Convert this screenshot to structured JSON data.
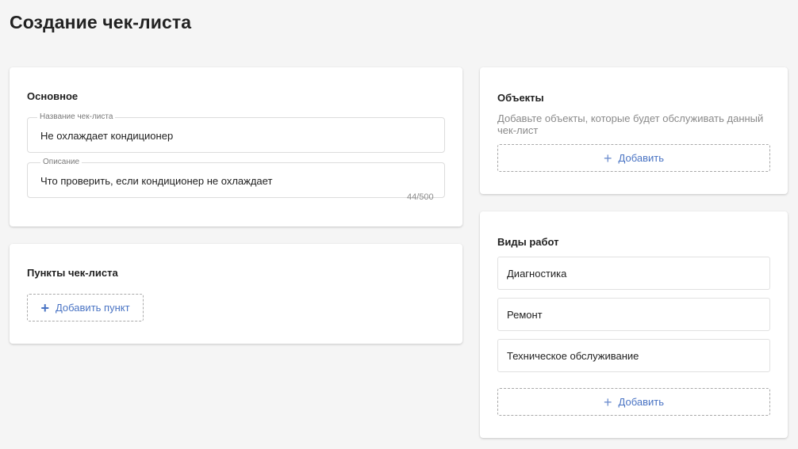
{
  "page": {
    "title": "Создание чек-листа"
  },
  "basic": {
    "title": "Основное",
    "name_field": {
      "label": "Название чек-листа",
      "value": "Не охлаждает кондиционер"
    },
    "description_field": {
      "label": "Описание",
      "value": "Что проверить, если кондиционер не охлаждает",
      "counter": "44/500"
    }
  },
  "checklist_items": {
    "title": "Пункты чек-листа",
    "add_label": "Добавить пункт"
  },
  "objects": {
    "title": "Объекты",
    "hint": "Добавьте объекты, которые будет обслуживать данный чек-лист",
    "add_label": "Добавить"
  },
  "work_types": {
    "title": "Виды работ",
    "items": [
      {
        "label": "Диагностика"
      },
      {
        "label": "Ремонт"
      },
      {
        "label": "Техническое обслуживание"
      }
    ],
    "add_label": "Добавить"
  },
  "icons": {
    "add": "plus-icon"
  },
  "colors": {
    "accent": "#4a74c4",
    "background": "#f5f5f5"
  }
}
